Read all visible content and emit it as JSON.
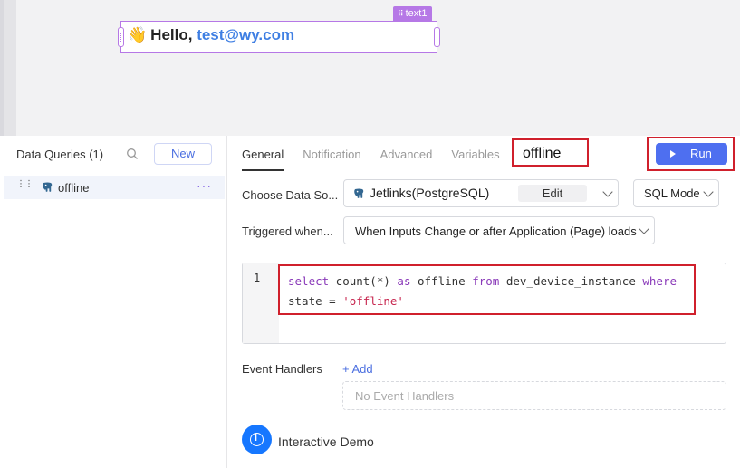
{
  "canvas": {
    "component_tag": "text1",
    "greeting_prefix": "Hello, ",
    "greeting_email": "test@wy.com",
    "wave_glyph": "👋"
  },
  "queries_panel": {
    "title": "Data Queries (1)",
    "new_label": "New",
    "items": [
      {
        "name": "offline",
        "icon": "postgres-icon"
      }
    ]
  },
  "editor": {
    "tabs": [
      "General",
      "Notification",
      "Advanced",
      "Variables"
    ],
    "active_tab": "General",
    "query_name": "offline",
    "run_label": "Run",
    "datasource_label": "Choose Data So...",
    "datasource_value": "Jetlinks(PostgreSQL)",
    "edit_label": "Edit",
    "mode_value": "SQL Mode",
    "trigger_label": "Triggered when...",
    "trigger_value": "When Inputs Change or after Application (Page) loads",
    "code_line_number": "1",
    "code_line1": "select count(*) as offline from dev_device_instance where",
    "code_line2": "state = 'offline'",
    "event_handlers_label": "Event Handlers",
    "add_label": "+ Add",
    "no_handlers": "No Event Handlers",
    "demo_label": "Interactive Demo"
  },
  "colors": {
    "accent": "#4e6ff0",
    "highlight": "#d0202c",
    "component_outline": "#b678e6",
    "info_blue": "#1677ff"
  }
}
